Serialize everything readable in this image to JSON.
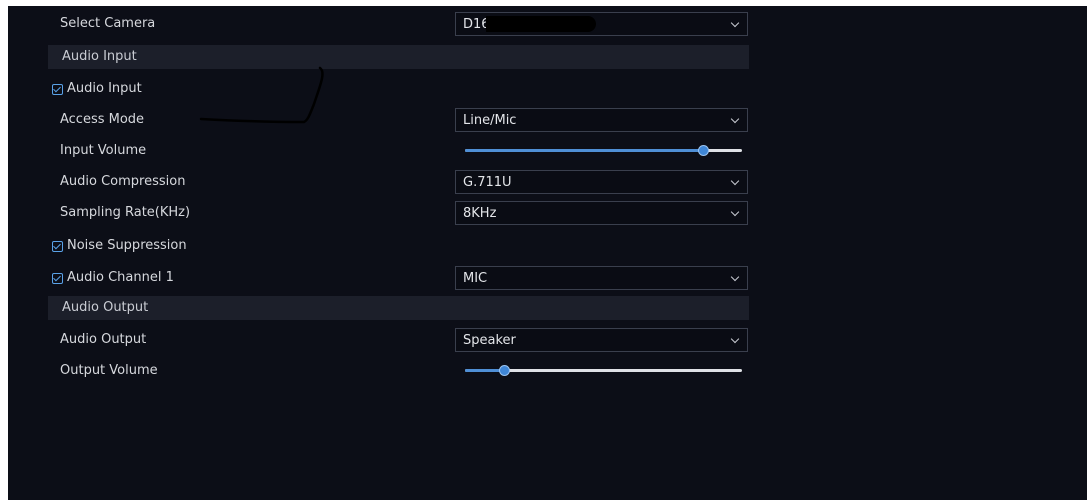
{
  "select_camera": {
    "label": "Select Camera",
    "value": "D16"
  },
  "audio_input_section": {
    "title": "Audio Input"
  },
  "audio_input": {
    "enable_label": "Audio Input",
    "enabled": true,
    "access_mode": {
      "label": "Access Mode",
      "value": "Line/Mic"
    },
    "input_volume": {
      "label": "Input Volume",
      "level_fraction": 0.86
    },
    "audio_compression": {
      "label": "Audio Compression",
      "value": "G.711U"
    },
    "sampling_rate": {
      "label": "Sampling Rate(KHz)",
      "value": "8KHz"
    },
    "noise_suppression": {
      "label": "Noise Suppression",
      "checked": true
    },
    "audio_channel_1": {
      "label": "Audio Channel 1",
      "checked": true,
      "value": "MIC"
    }
  },
  "audio_output_section": {
    "title": "Audio Output"
  },
  "audio_output": {
    "output": {
      "label": "Audio Output",
      "value": "Speaker"
    },
    "output_volume": {
      "label": "Output Volume",
      "level_fraction": 0.14
    }
  },
  "colors": {
    "background": "#0c0e17",
    "section": "#1c1f2a",
    "accent": "#4f8fd6",
    "text": "#d6d8dd"
  },
  "icons": {
    "dropdown": "chevron-down-icon",
    "checkbox": "checkbox-checked-icon"
  }
}
